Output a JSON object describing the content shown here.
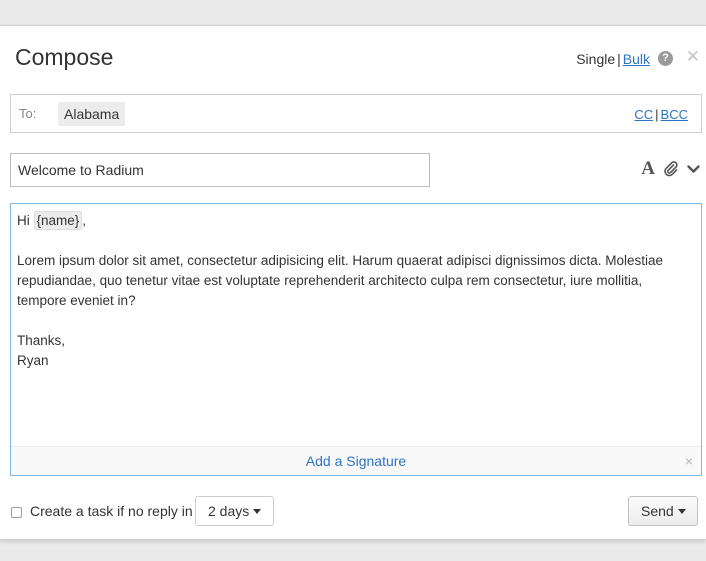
{
  "header": {
    "title": "Compose",
    "mode_single": "Single",
    "mode_separator": "|",
    "mode_bulk": "Bulk",
    "help_icon": "question-circle-icon",
    "close_icon": "close-icon"
  },
  "recipients": {
    "to_label": "To:",
    "chips": [
      "Alabama"
    ],
    "cc_label": "CC",
    "separator": "|",
    "bcc_label": "BCC"
  },
  "subject": {
    "value": "Welcome to Radium"
  },
  "toolbar": {
    "icons": [
      "font-format-icon",
      "paperclip-icon",
      "chevron-down-icon"
    ],
    "font_glyph": "A"
  },
  "editor": {
    "greeting_prefix": "Hi ",
    "merge_tag": "{name}",
    "greeting_suffix": ",",
    "paragraph": "Lorem ipsum dolor sit amet, consectetur adipisicing elit. Harum quaerat adipisci dignissimos dicta. Molestiae repudiandae, quo tenetur vitae est voluptate reprehenderit architecto culpa rem consectetur, iure mollitia, tempore eveniet in?",
    "closing": "Thanks,",
    "sender": "Ryan",
    "add_signature": "Add a Signature",
    "close_glyph": "×"
  },
  "footer": {
    "task_label": "Create a task if no reply in",
    "task_checked": false,
    "delay_value": "2 days",
    "send_label": "Send"
  },
  "colors": {
    "link": "#2b73c5",
    "editor_border": "#82b7e6",
    "background": "#e9e9e9"
  }
}
